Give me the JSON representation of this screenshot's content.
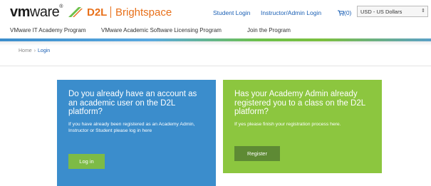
{
  "header": {
    "logo_vm_bold": "vm",
    "logo_vm_rest": "ware",
    "logo_vm_reg": "®",
    "logo_d2l": "D2L",
    "logo_bright": "Brightspace",
    "student_login": "Student Login",
    "instructor_login": "Instructor/Admin Login",
    "cart_count": "(0)",
    "currency": "USD - US Dollars",
    "colors": {
      "link": "#1a5fb4",
      "brand_orange": "#e8701a"
    }
  },
  "nav": {
    "items": [
      "VMware IT Academy Program",
      "VMware Academic Software Licensing Program",
      "Join the Program"
    ]
  },
  "breadcrumb": {
    "home": "Home",
    "separator": "›",
    "current": "Login"
  },
  "cards": {
    "academic": {
      "heading": "Do you already have an account as an academic user on the D2L platform?",
      "body": "If you have already been registered as an Academy Admin, Instructor or Student please log in here",
      "button": "Log in",
      "color": "#3b8dcc"
    },
    "admin": {
      "heading": "Has your Academy Admin already registered you to a class on the D2L platform?",
      "body": "If yes please finish your registration process here.",
      "button": "Register",
      "color": "#8cc63f"
    }
  }
}
